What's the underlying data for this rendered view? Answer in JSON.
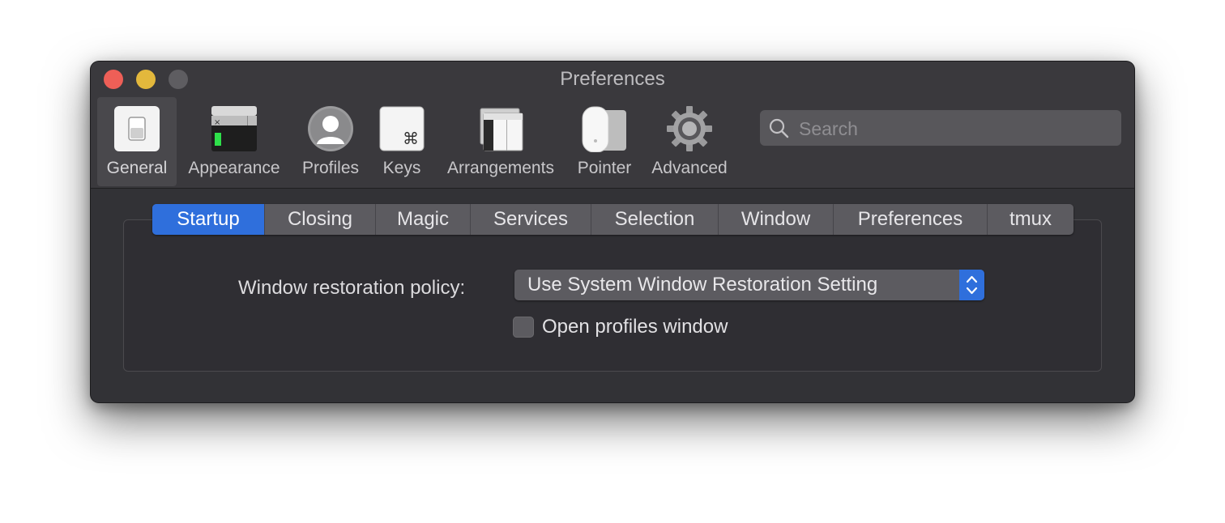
{
  "window": {
    "title": "Preferences"
  },
  "toolbar": {
    "items": [
      {
        "label": "General",
        "icon": "switch-icon",
        "selected": true
      },
      {
        "label": "Appearance",
        "icon": "terminal-window-icon"
      },
      {
        "label": "Profiles",
        "icon": "user-silhouette-icon"
      },
      {
        "label": "Keys",
        "icon": "command-key-icon"
      },
      {
        "label": "Arrangements",
        "icon": "window-arrangement-icon"
      },
      {
        "label": "Pointer",
        "icon": "mouse-icon"
      },
      {
        "label": "Advanced",
        "icon": "gear-icon"
      }
    ]
  },
  "search": {
    "placeholder": "Search",
    "value": ""
  },
  "tabs": [
    "Startup",
    "Closing",
    "Magic",
    "Services",
    "Selection",
    "Window",
    "Preferences",
    "tmux"
  ],
  "active_tab": "Startup",
  "startup": {
    "restoration_label": "Window restoration policy:",
    "restoration_value": "Use System Window Restoration Setting",
    "open_profiles_label": "Open profiles window",
    "open_profiles_checked": false
  },
  "colors": {
    "accent": "#2f6fdc",
    "close": "#ee5f57",
    "minimize": "#e3b83c",
    "zoom_disabled": "#5e5d61",
    "window_bg": "#323236"
  }
}
